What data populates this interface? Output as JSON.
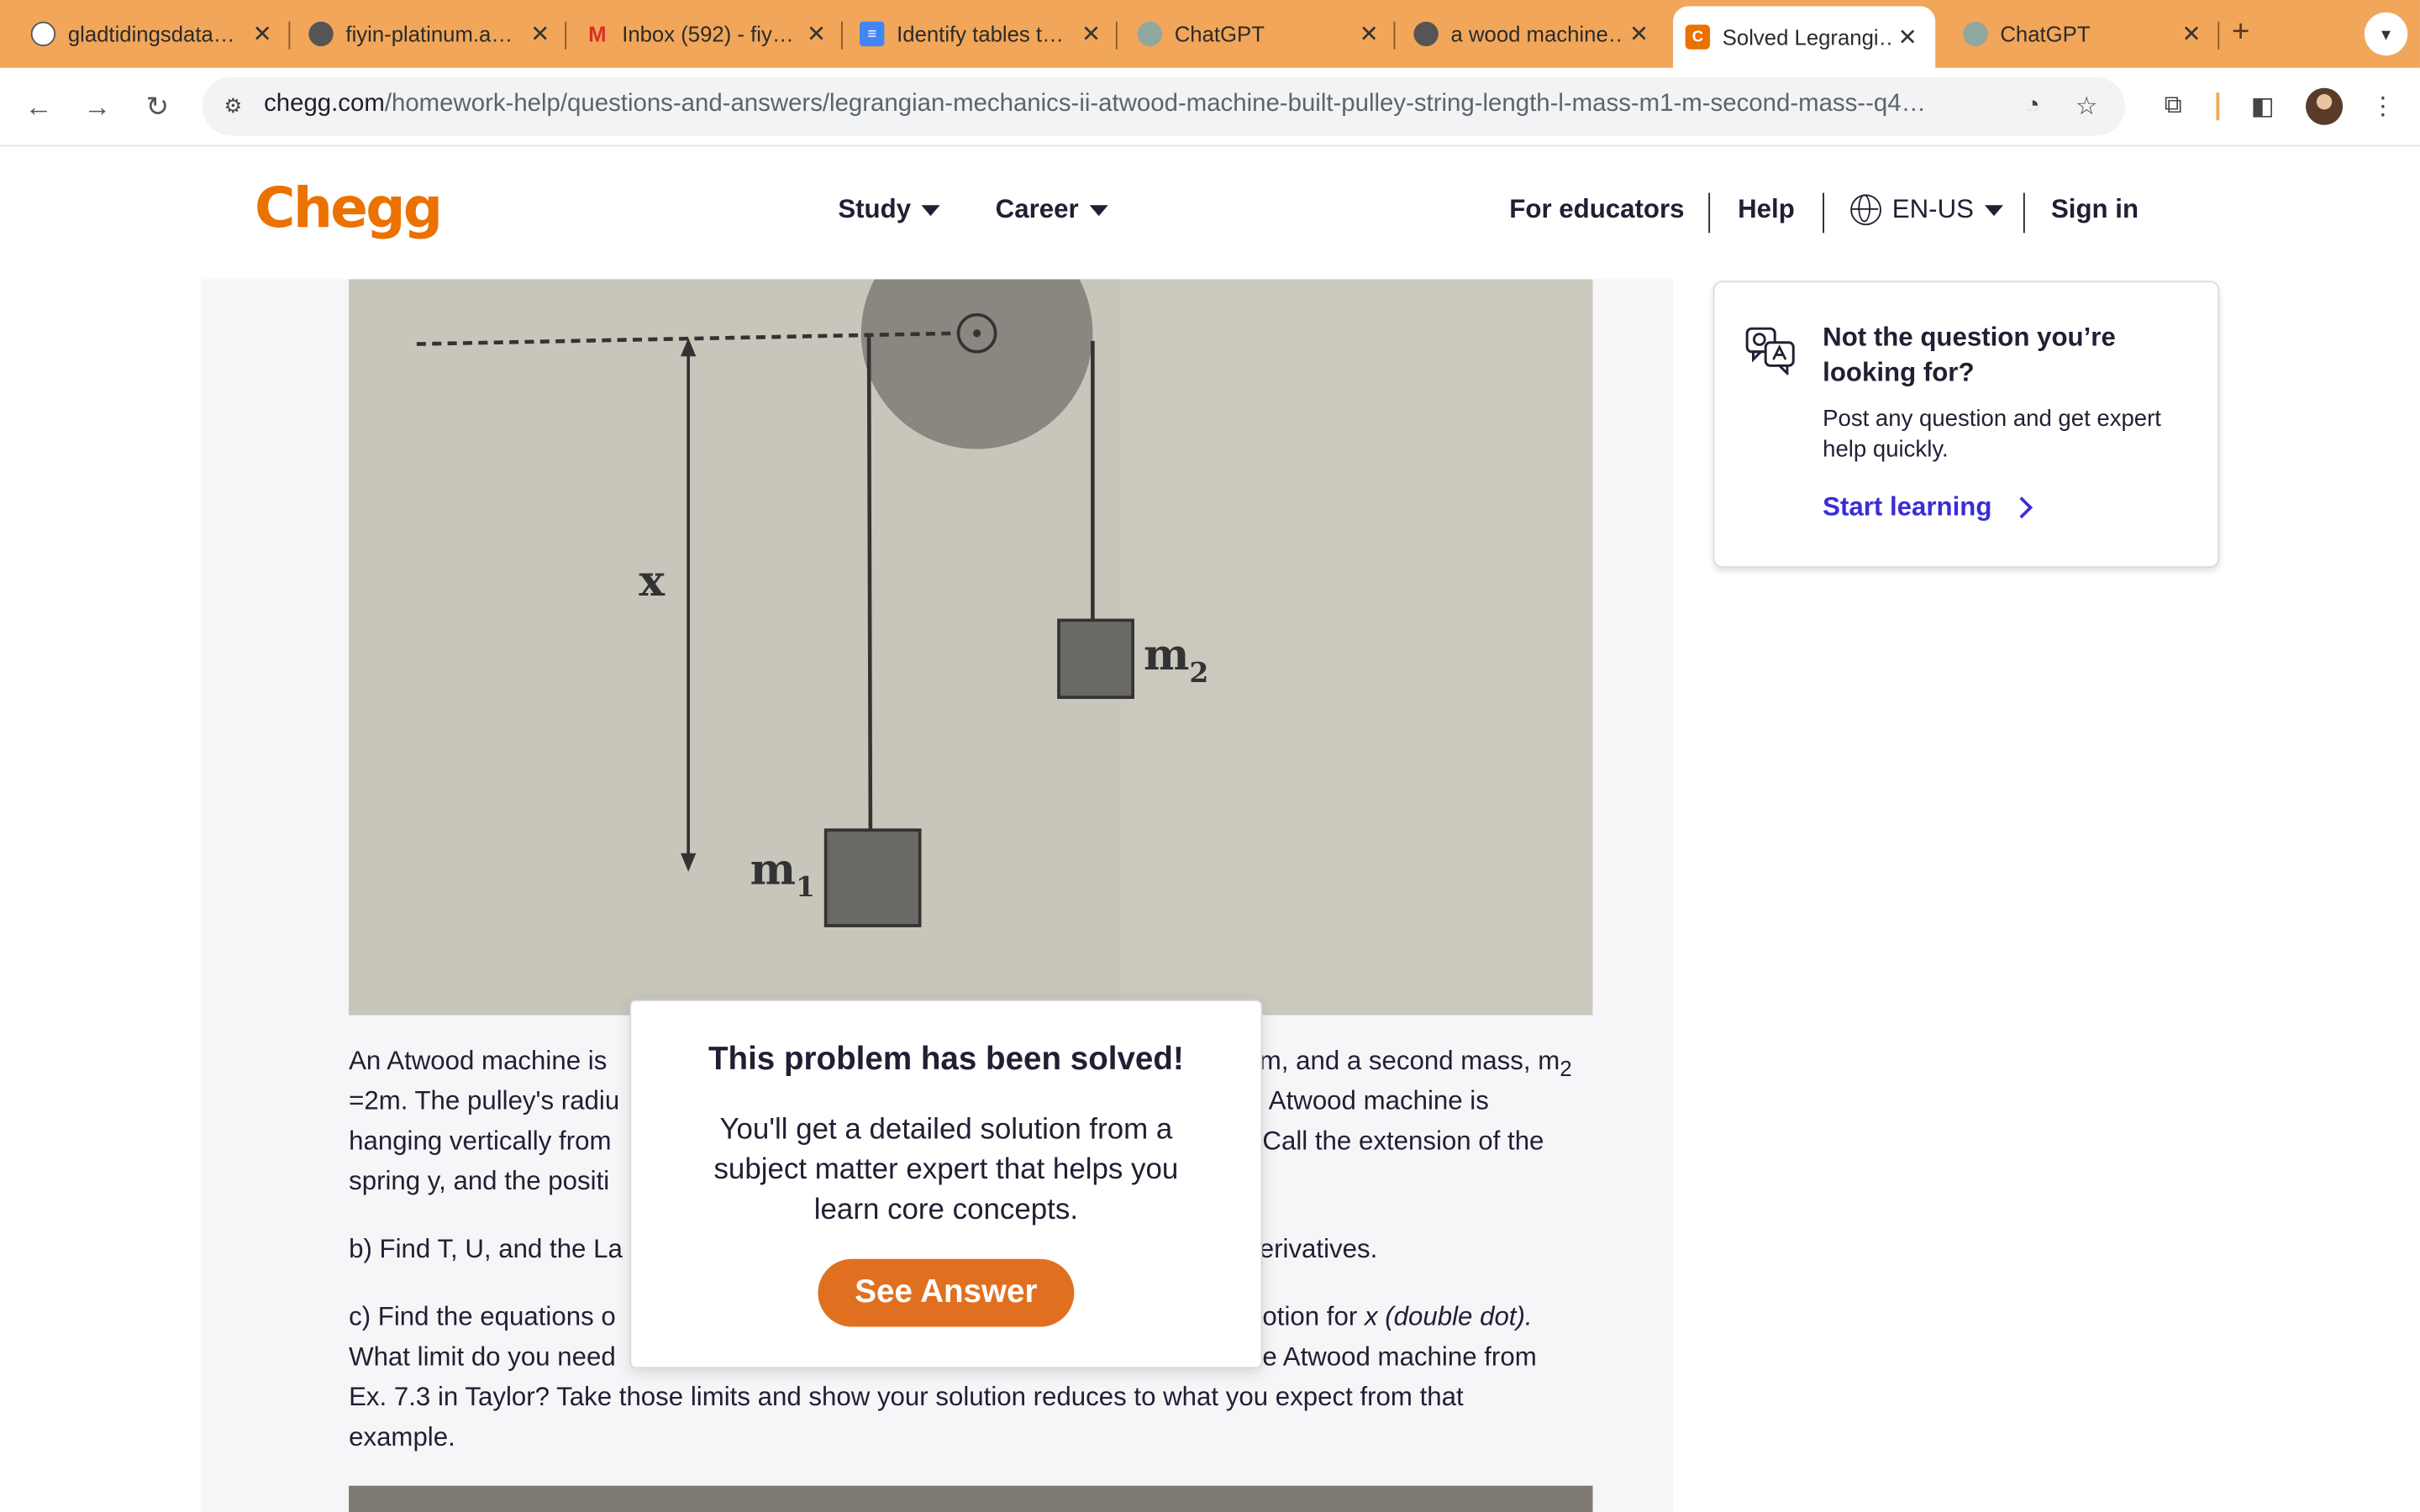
{
  "browser": {
    "tabs": [
      {
        "title": "gladtidingsdata…",
        "icon": "chatgpt-icon"
      },
      {
        "title": "fiyin-platinum.a…",
        "icon": "globe-icon"
      },
      {
        "title": "Inbox (592) - fiy…",
        "icon": "gmail-icon"
      },
      {
        "title": "Identify tables t…",
        "icon": "docs-icon"
      },
      {
        "title": "ChatGPT",
        "icon": "chatgpt-icon"
      },
      {
        "title": "a wood machine…",
        "icon": "globe-icon"
      },
      {
        "title": "Solved Legrangi…",
        "icon": "chegg-icon",
        "active": true
      },
      {
        "title": "ChatGPT",
        "icon": "chatgpt-icon"
      }
    ],
    "url_host": "chegg.com",
    "url_path": "/homework-help/questions-and-answers/legrangian-mechanics-ii-atwood-machine-built-pulley-string-length-l-mass-m1-m-second-mass--q4…",
    "accent_color": "#f2a65a"
  },
  "header": {
    "logo": "Chegg",
    "nav": {
      "study": "Study",
      "career": "Career"
    },
    "right": {
      "educators": "For educators",
      "help": "Help",
      "locale": "EN-US",
      "signin": "Sign in"
    },
    "brand_color": "#eb7100"
  },
  "figure": {
    "label_x": "x",
    "label_m1": "m",
    "sub_m1": "1",
    "label_m2": "m",
    "sub_m2": "2"
  },
  "question": {
    "p1_l1_a": "An Atwood machine is",
    "p1_l1_b": "m, and a second mass, m",
    "p1_l1_sub": "2",
    "p1_l2_a": "=2m. The pulley's radiu",
    "p1_l2_b": "Atwood machine is",
    "p1_l3_a": "hanging vertically from",
    "p1_l3_b": "Call the extension of the",
    "p1_l4_a": "spring y, and the positi",
    "p2_a": "b) Find T, U, and the La",
    "p2_b": "erivatives.",
    "p3_l1_a": "c) Find the equations o",
    "p3_l1_b": "otion for",
    "p3_l1_em": "x (double dot).",
    "p3_l2_a": "What limit do you need",
    "p3_l2_b": "e Atwood machine from",
    "p3_l3": "Ex. 7.3 in Taylor? Take those limits and show your solution reduces to what you expect from that",
    "p3_l4": "example."
  },
  "side_card": {
    "title": "Not the question you’re looking for?",
    "body": "Post any question and get expert help quickly.",
    "link": "Start learning"
  },
  "modal": {
    "title": "This problem has been solved!",
    "body": "You'll get a detailed solution from a subject matter expert that helps you learn core concepts.",
    "button": "See Answer",
    "button_color": "#e07020"
  }
}
